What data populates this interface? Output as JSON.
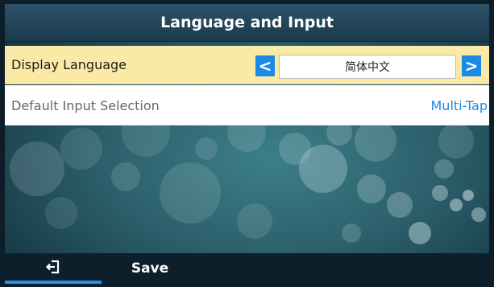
{
  "header": {
    "title": "Language and Input"
  },
  "settings": {
    "display_language": {
      "label": "Display Language",
      "value": "简体中文",
      "prev_glyph": "<",
      "next_glyph": ">"
    },
    "default_input": {
      "label": "Default Input Selection",
      "value": "Multi-Tap"
    }
  },
  "softkeys": {
    "back_icon": "exit-icon",
    "save_label": "Save"
  },
  "colors": {
    "accent": "#1a8ae6",
    "highlight_row": "#fbeaa6",
    "title_bar": "#1f4257"
  }
}
